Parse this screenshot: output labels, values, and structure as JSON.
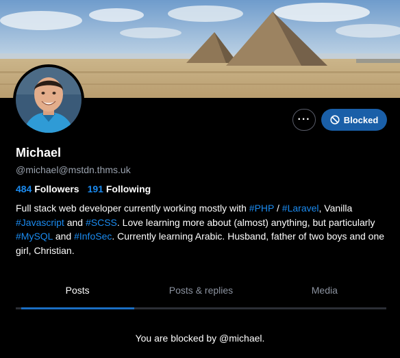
{
  "profile": {
    "display_name": "Michael",
    "handle": "@michael@mstdn.thms.uk",
    "followers_count": "484",
    "followers_label": "Followers",
    "following_count": "191",
    "following_label": "Following",
    "bio": {
      "p1": "Full stack web developer currently working mostly with ",
      "tag_php": "#PHP",
      "p2": " / ",
      "tag_laravel": "#Laravel",
      "p3": ", Vanilla ",
      "tag_javascript": "#Javascript",
      "p4": " and ",
      "tag_scss": "#SCSS",
      "p5": ". Love learning more about (almost) anything, but particularly ",
      "tag_mysql": "#MySQL",
      "p6": " and ",
      "tag_infosec": "#InfoSec",
      "p7": ". Currently learning Arabic. Husband, father of two boys and one girl, Christian."
    }
  },
  "actions": {
    "more_label": "···",
    "blocked_label": "Blocked"
  },
  "tabs": [
    {
      "label": "Posts",
      "active": true
    },
    {
      "label": "Posts & replies",
      "active": false
    },
    {
      "label": "Media",
      "active": false
    }
  ],
  "blocked_message": "You are blocked by @michael.",
  "icons": {
    "more": "ellipsis-icon",
    "blocked": "block-icon"
  },
  "colors": {
    "accent": "#1b8bf0",
    "blocked_button": "#1a5fa8",
    "background": "#000000",
    "muted_text": "#9ba3af"
  }
}
